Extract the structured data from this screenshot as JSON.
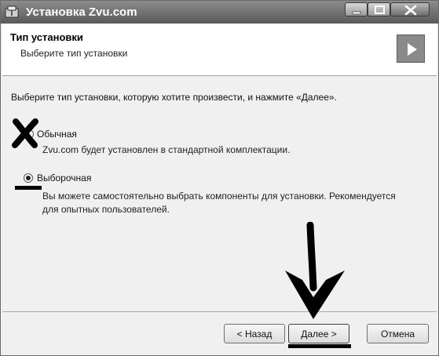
{
  "window": {
    "title": "Установка Zvu.com"
  },
  "header": {
    "title": "Тип установки",
    "subtitle": "Выберите тип установки"
  },
  "content": {
    "instruction": "Выберите тип установки, которую хотите произвести, и нажмите «Далее».",
    "options": [
      {
        "label": "Обычная",
        "description": "Zvu.com будет установлен в стандартной комплектации.",
        "selected": false
      },
      {
        "label": "Выборочная",
        "description_line1": "Вы можете самостоятельно выбрать компоненты для установки. Рекомендуется",
        "description_line2": "для опытных пользователей.",
        "selected": true
      }
    ]
  },
  "footer": {
    "back_label": "< Назад",
    "next_label": "Далее >",
    "cancel_label": "Отмена"
  },
  "icons": {
    "app": "installer-icon",
    "header": "play-arrow-icon",
    "annotation_cross": "cross-mark-icon",
    "annotation_arrow": "down-arrow-icon"
  }
}
